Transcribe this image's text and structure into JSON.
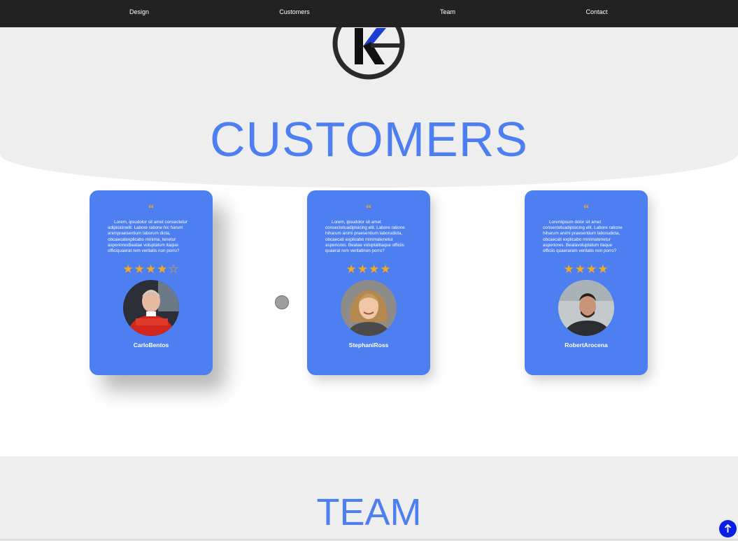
{
  "nav": {
    "items": [
      {
        "label": "Design"
      },
      {
        "label": "Customers"
      },
      {
        "label": "Team"
      },
      {
        "label": "Contact"
      }
    ]
  },
  "hero": {
    "title": "CUSTOMERS",
    "logo_icon": "kg-circle-logo"
  },
  "testimonials": [
    {
      "quote_mark": "“",
      "text": "Lorem, ipsudolor sit amet consectetur adipisicinelit. Labore ratione hic harum animpraesentium laborum dicta, obcaecatexplicabo minima, tenetur asperioresBeatae voluptatum itaque officiquaerat rem veritatis non porro?",
      "rating": 4,
      "max_rating": 5,
      "stars": "★★★★☆",
      "name": "CarloBentos"
    },
    {
      "quote_mark": "“",
      "text": "Lorem, ipsudolor sit amet consectetuadipisicing elit. Labore ratione hiharum animi praesentium laborudicta, obcaecati explicabo minimatenetur asperiores. Beatae voluptatitaque officiis quaerat rem veritatinon porro?",
      "rating": 4,
      "max_rating": 4,
      "stars": "★★★★",
      "name": "StephaniRoss"
    },
    {
      "quote_mark": "“",
      "text": "Loremipsum dolor sit amet consectetuadipisicing elit. Labore ratione hiharum animi praesentium laborudicta, obcaecati explicabo minimatenetur asperiores. Beatavoluptatum itaque officiis quaeraram veritatis non porro?",
      "rating": 4,
      "max_rating": 4,
      "stars": "★★★★",
      "name": "RobertArocena"
    }
  ],
  "team": {
    "title": "TEAM"
  },
  "scroll_top_icon": "arrow-up-icon",
  "colors": {
    "accent": "#4e7ff0",
    "nav_bg": "#222222",
    "star": "#f5a623",
    "section_bg": "#eeeeef",
    "scroll_button": "#0a1fe6"
  }
}
